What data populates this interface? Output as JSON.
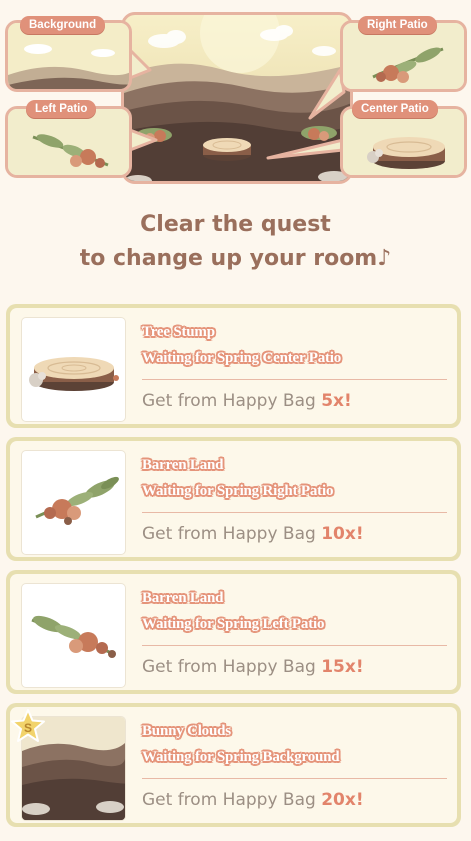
{
  "preview": {
    "labels": {
      "background": "Background",
      "right_patio": "Right Patio",
      "left_patio": "Left Patio",
      "center_patio": "Center Patio"
    }
  },
  "heading": {
    "line1": "Clear the quest",
    "line2": "to change up your room♪"
  },
  "quests": [
    {
      "title": "Tree Stump",
      "subtitle": "Waiting for Spring Center Patio",
      "get_prefix": "Get from Happy Bag",
      "count": "5x!",
      "thumb_icon": "tree-stump-icon"
    },
    {
      "title": "Barren Land",
      "subtitle": "Waiting for Spring Right Patio",
      "get_prefix": "Get from Happy Bag",
      "count": "10x!",
      "thumb_icon": "flower-branch-icon"
    },
    {
      "title": "Barren Land",
      "subtitle": "Waiting for Spring Left Patio",
      "get_prefix": "Get from Happy Bag",
      "count": "15x!",
      "thumb_icon": "flower-branch-icon"
    },
    {
      "title": "Bunny Clouds",
      "subtitle": "Waiting for Spring Background",
      "get_prefix": "Get from Happy Bag",
      "count": "20x!",
      "thumb_icon": "hill-landscape-icon",
      "badge": "S"
    }
  ],
  "colors": {
    "page_bg": "#fdf7ee",
    "accent": "#e0917a",
    "card_border": "#e7dfb0",
    "heading": "#9a6f5c",
    "muted_text": "#9c8f84"
  }
}
